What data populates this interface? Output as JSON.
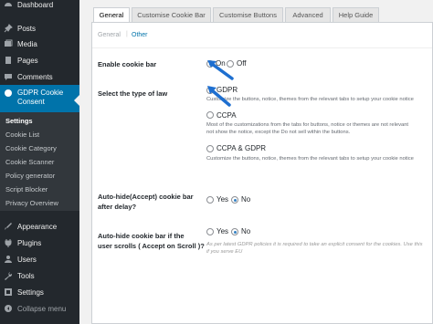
{
  "sidebar": {
    "items": [
      {
        "label": "Dashboard",
        "icon": "dashboard-icon"
      },
      {
        "label": "Posts",
        "icon": "pin-icon"
      },
      {
        "label": "Media",
        "icon": "media-icon"
      },
      {
        "label": "Pages",
        "icon": "pages-icon"
      },
      {
        "label": "Comments",
        "icon": "comment-icon"
      },
      {
        "label": "GDPR Cookie Consent",
        "icon": "gdpr-icon"
      },
      {
        "label": "Appearance",
        "icon": "brush-icon"
      },
      {
        "label": "Plugins",
        "icon": "plug-icon"
      },
      {
        "label": "Users",
        "icon": "user-icon"
      },
      {
        "label": "Tools",
        "icon": "wrench-icon"
      },
      {
        "label": "Settings",
        "icon": "settings-icon"
      },
      {
        "label": "Collapse menu",
        "icon": "collapse-icon"
      }
    ],
    "active_label_line1": "GDPR Cookie",
    "active_label_line2": "Consent",
    "submenu": [
      "Settings",
      "Cookie List",
      "Cookie Category",
      "Cookie Scanner",
      "Policy generator",
      "Script Blocker",
      "Privacy Overview"
    ]
  },
  "tabs": [
    "General",
    "Customise Cookie Bar",
    "Customise Buttons",
    "Advanced",
    "Help Guide"
  ],
  "subnav": {
    "general": "General",
    "separator": "|",
    "other": "Other"
  },
  "settings": {
    "enable_label": "Enable cookie bar",
    "enable_on": "On",
    "enable_off": "Off",
    "law_label": "Select the type of law",
    "law_gdpr": "GDPR",
    "law_gdpr_desc": "Customize the buttons, notice, themes from the relevant tabs to setup your cookie notice",
    "law_ccpa": "CCPA",
    "law_ccpa_desc1": "Most of the customizations from the tabs for buttons, notice or themes are not relevant",
    "law_ccpa_desc2": "not show the notice, except the Do not sell within the buttons.",
    "law_both": "CCPA & GDPR",
    "law_both_desc": "Customize the buttons, notice, themes from the relevant tabs to setup your cookie notice",
    "autohide_label1": "Auto-hide(Accept) cookie bar",
    "autohide_label2": "after delay?",
    "autohide_yes": "Yes",
    "autohide_no": "No",
    "scroll_label1": "Auto-hide cookie bar if the",
    "scroll_label2": "user scrolls ( Accept on Scroll )?",
    "scroll_yes": "Yes",
    "scroll_no": "No",
    "scroll_desc1": "As per latest GDPR policies it is required to take an explicit consent for the cookies. Use this",
    "scroll_desc2": "if you serve EU"
  },
  "colors": {
    "sidebar": "#23282d",
    "active": "#0073aa",
    "arrow": "#1e6fd0"
  }
}
